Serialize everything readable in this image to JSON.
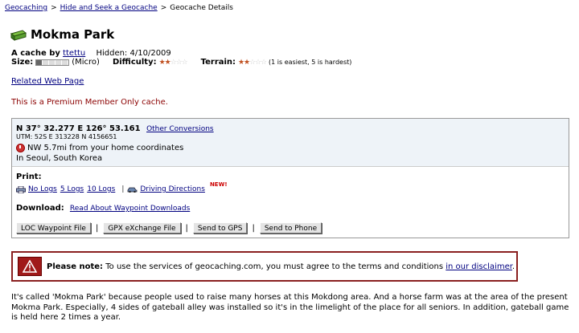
{
  "breadcrumb": {
    "item1": "Geocaching",
    "sep1": ">",
    "item2": "Hide and Seek a Geocache",
    "sep2": ">",
    "item3": "Geocache Details"
  },
  "cache": {
    "name": "Mokma Park",
    "by_label": "A cache by",
    "owner": "ttettu",
    "hidden_label": "Hidden:",
    "hidden_date": "4/10/2009",
    "size_label": "Size:",
    "size_value": "(Micro)",
    "size_level": 1,
    "size_max": 5,
    "difficulty_label": "Difficulty:",
    "difficulty": 2,
    "terrain_label": "Terrain:",
    "terrain": 2,
    "rating_scale": "(1 is easiest, 5 is hardest)"
  },
  "related_link": "Related Web Page",
  "premium_text": "This is a Premium Member Only cache.",
  "coords": {
    "main": "N 37° 32.277 E 126° 53.161",
    "other_link": "Other Conversions",
    "utm": "UTM: 52S E 313228 N 4156651",
    "distance": "NW 5.7mi from your home coordinates",
    "location": "In Seoul, South Korea"
  },
  "print": {
    "label": "Print:",
    "no_logs": "No Logs",
    "five_logs": "5 Logs",
    "ten_logs": "10 Logs",
    "pipe": "|",
    "driving": "Driving Directions",
    "new_badge": "NEW!"
  },
  "download": {
    "label": "Download:",
    "link": "Read About Waypoint Downloads"
  },
  "buttons": {
    "loc": "LOC Waypoint File",
    "gpx": "GPX eXchange File",
    "gps": "Send to GPS",
    "phone": "Send to Phone",
    "pipe": "|"
  },
  "note": {
    "bold": "Please note:",
    "text": "To use the services of geocaching.com, you must agree to the terms and conditions",
    "link": "in our disclaimer",
    "end": "."
  },
  "description": "It's called 'Mokma Park' because people used to raise many horses at this Mokdong area. And a horse farm was at the area of the present Mokma Park. Especially, 4 sides of gateball alley was installed so it's in the limelight of the place for all seniors. In addition, gateball game is held here 2 times a year.",
  "colors": {
    "link": "#000080",
    "premium": "#8b0000",
    "star_full": "#c05020",
    "box_bg": "#eef3f8",
    "warn": "#a01a1a"
  }
}
